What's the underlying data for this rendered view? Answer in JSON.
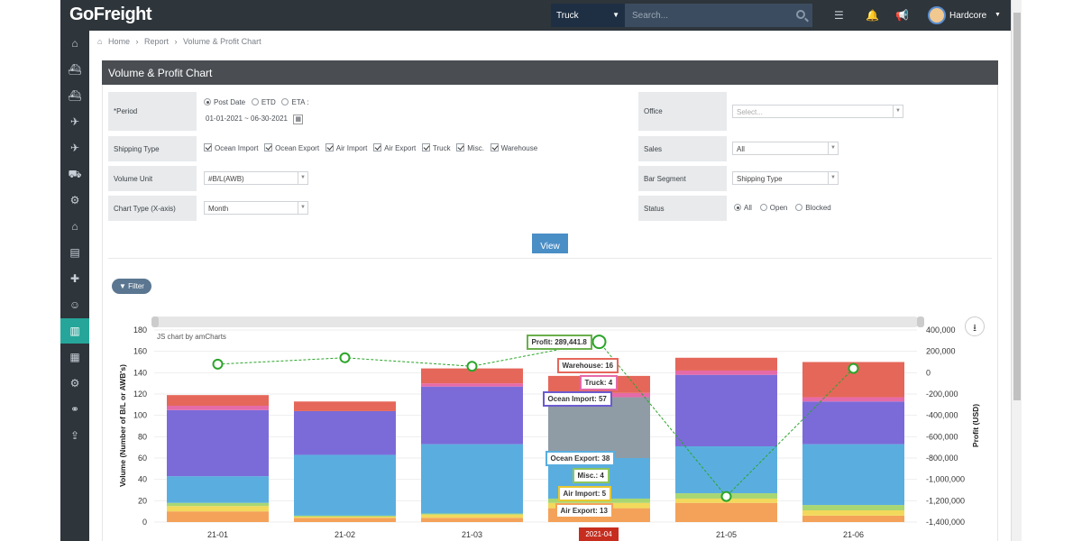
{
  "app": {
    "logo": "GoFreight"
  },
  "header": {
    "mode_select": "Truck",
    "search_placeholder": "Search...",
    "user_name": "Hardcore"
  },
  "breadcrumb": {
    "home": "Home",
    "sep1": "›",
    "report": "Report",
    "sep2": "›",
    "current": "Volume & Profit Chart"
  },
  "panel": {
    "title": "Volume & Profit Chart"
  },
  "form": {
    "period_label": "*Period",
    "period_options": [
      "Post Date",
      "ETD",
      "ETA :"
    ],
    "period_range": "01-01-2021 ~ 06-30-2021",
    "office_label": "Office",
    "office_placeholder": "Select...",
    "shipping_label": "Shipping Type",
    "shipping_types": [
      "Ocean Import",
      "Ocean Export",
      "Air Import",
      "Air Export",
      "Truck",
      "Misc.",
      "Warehouse"
    ],
    "sales_label": "Sales",
    "sales_value": "All",
    "volume_unit_label": "Volume Unit",
    "volume_unit_value": "#B/L(AWB)",
    "bar_segment_label": "Bar Segment",
    "bar_segment_value": "Shipping Type",
    "chart_type_label": "Chart Type (X-axis)",
    "chart_type_value": "Month",
    "status_label": "Status",
    "status_options": [
      "All",
      "Open",
      "Blocked"
    ],
    "view_label": "View",
    "filter_label": "Filter"
  },
  "chart_data": {
    "type": "bar",
    "credit": "JS chart by amCharts",
    "categories": [
      "2021-01",
      "2021-02",
      "2021-03",
      "2021-04",
      "2021-05",
      "2021-06"
    ],
    "x_tick_labels": [
      "21-01",
      "21-02",
      "21-03",
      "2021-04",
      "21-05",
      "21-06"
    ],
    "selected_category": "2021-04",
    "ylabel": "Volume (Number of B/L or AWB's)",
    "y2label": "Profit (USD)",
    "ylim": [
      0,
      180
    ],
    "y_ticks": [
      0,
      20,
      40,
      60,
      80,
      100,
      120,
      140,
      160,
      180
    ],
    "y2lim": [
      -1400000,
      400000
    ],
    "y2_ticks": [
      "400,000",
      "200,000",
      "0",
      "-200,000",
      "-400,000",
      "-600,000",
      "-800,000",
      "-1,000,000",
      "-1,200,000",
      "-1,400,000"
    ],
    "series": [
      {
        "name": "Air Export",
        "color": "#f4a259",
        "values": [
          10,
          4,
          4,
          13,
          18,
          6
        ]
      },
      {
        "name": "Air Import",
        "color": "#f2d95c",
        "values": [
          5,
          1,
          3,
          5,
          4,
          5
        ]
      },
      {
        "name": "Misc.",
        "color": "#a8d672",
        "values": [
          3,
          1,
          1,
          4,
          5,
          5
        ]
      },
      {
        "name": "Ocean Export",
        "color": "#5aaedf",
        "values": [
          25,
          57,
          65,
          38,
          44,
          57
        ]
      },
      {
        "name": "Ocean Import",
        "color": "#7b6bd8",
        "values": [
          62,
          41,
          54,
          57,
          67,
          40
        ]
      },
      {
        "name": "Truck",
        "color": "#e56aa8",
        "values": [
          4,
          0,
          3,
          4,
          4,
          4
        ]
      },
      {
        "name": "Warehouse",
        "color": "#e5675a",
        "values": [
          10,
          9,
          14,
          16,
          12,
          33
        ]
      }
    ],
    "profit": {
      "name": "Profit",
      "color": "#2aa52a",
      "values": [
        80000,
        140000,
        60000,
        289441.8,
        -1160000,
        40000
      ]
    },
    "tooltips": [
      {
        "label": "Profit: 289,441.8",
        "color": "#6ab04c"
      },
      {
        "label": "Warehouse: 16",
        "color": "#e5675a"
      },
      {
        "label": "Truck: 4",
        "color": "#e56aa8"
      },
      {
        "label": "Ocean Import: 57",
        "color": "#6b5bd0"
      },
      {
        "label": "Ocean Export: 38",
        "color": "#5aaedf"
      },
      {
        "label": "Misc.: 4",
        "color": "#8cc55c"
      },
      {
        "label": "Air Import: 5",
        "color": "#e8c830"
      },
      {
        "label": "Air Export: 13",
        "color": "#f4a259"
      }
    ]
  }
}
